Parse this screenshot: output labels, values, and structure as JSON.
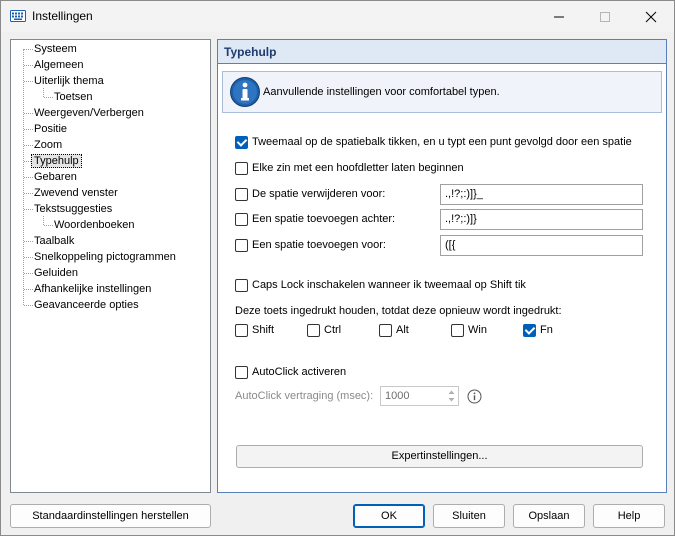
{
  "window": {
    "title": "Instellingen"
  },
  "tree": {
    "items": [
      {
        "label": "Systeem"
      },
      {
        "label": "Algemeen"
      },
      {
        "label": "Uiterlijk thema"
      },
      {
        "label": "Toetsen"
      },
      {
        "label": "Weergeven/Verbergen"
      },
      {
        "label": "Positie"
      },
      {
        "label": "Zoom"
      },
      {
        "label": "Typehulp",
        "selected": true
      },
      {
        "label": "Gebaren"
      },
      {
        "label": "Zwevend venster"
      },
      {
        "label": "Tekstsuggesties"
      },
      {
        "label": "Woordenboeken"
      },
      {
        "label": "Taalbalk"
      },
      {
        "label": "Snelkoppeling pictogrammen"
      },
      {
        "label": "Geluiden"
      },
      {
        "label": "Afhankelijke instellingen"
      },
      {
        "label": "Geavanceerde opties"
      }
    ]
  },
  "panel": {
    "title": "Typehulp",
    "info_text": "Aanvullende instellingen voor comfortabel typen.",
    "double_space": {
      "label": "Tweemaal op de spatiebalk tikken, en u typt een punt gevolgd door een spatie",
      "checked": true
    },
    "capitalize": {
      "label": "Elke zin met een hoofdletter laten beginnen",
      "checked": false
    },
    "remove_space_before": {
      "label": "De spatie verwijderen voor:",
      "checked": false,
      "value": ".,!?;:)]}_"
    },
    "add_space_after": {
      "label": "Een spatie toevoegen achter:",
      "checked": false,
      "value": ".,!?;:)]}"
    },
    "add_space_before": {
      "label": "Een spatie toevoegen voor:",
      "checked": false,
      "value": "([{"
    },
    "caps_lock": {
      "label": "Caps Lock inschakelen wanneer ik tweemaal op Shift tik",
      "checked": false
    },
    "hold_keys_label": "Deze toets ingedrukt houden, totdat deze opnieuw wordt ingedrukt:",
    "hold_keys": [
      {
        "label": "Shift",
        "checked": false
      },
      {
        "label": "Ctrl",
        "checked": false
      },
      {
        "label": "Alt",
        "checked": false
      },
      {
        "label": "Win",
        "checked": false
      },
      {
        "label": "Fn",
        "checked": true
      }
    ],
    "autoclick": {
      "label": "AutoClick activeren",
      "checked": false
    },
    "autoclick_delay_label": "AutoClick vertraging (msec):",
    "autoclick_delay_value": "1000",
    "expert_button": "Expertinstellingen..."
  },
  "footer": {
    "reset_button": "Standaardinstellingen herstellen",
    "ok_button": "OK",
    "close_button": "Sluiten",
    "save_button": "Opslaan",
    "help_button": "Help"
  },
  "colors": {
    "accent": "#005fb8",
    "panel_header_bg": "#dfe8f5",
    "panel_border": "#5b7fb8"
  }
}
